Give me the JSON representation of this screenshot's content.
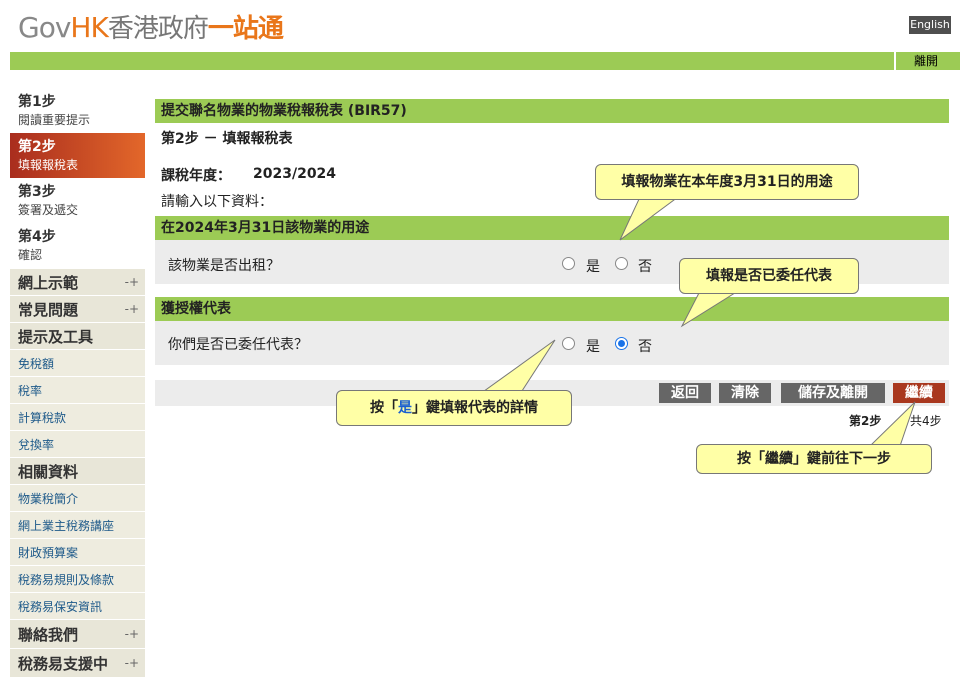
{
  "header": {
    "logo_gov": "Gov",
    "logo_hk": "HK",
    "logo_zh": "香港政府",
    "logo_zh_bold": "一站通",
    "english_label": "English",
    "logout_label": "離開"
  },
  "sidebar": {
    "steps": [
      {
        "num": "第1步",
        "desc": "閱讀重要提示"
      },
      {
        "num": "第2步",
        "desc": "填報報稅表"
      },
      {
        "num": "第3步",
        "desc": "簽署及遞交"
      },
      {
        "num": "第4步",
        "desc": "確認"
      }
    ],
    "nav": {
      "demo": "網上示範",
      "faq": "常見問題",
      "tips": "提示及工具",
      "tips_items": [
        "免稅額",
        "稅率",
        "計算稅款",
        "兌換率"
      ],
      "related": "相關資料",
      "related_items": [
        "物業稅簡介",
        "網上業主稅務講座",
        "財政預算案",
        "稅務易規則及條款",
        "稅務易保安資訊"
      ],
      "contact": "聯絡我們",
      "support": "稅務易支援中"
    }
  },
  "main": {
    "form_title": "提交聯名物業的物業稅報稅表 (BIR57)",
    "step_heading": "第2步  －  填報報稅表",
    "assessment_label": "課稅年度：",
    "assessment_year": "2023/2024",
    "instruction": "請輸入以下資料：",
    "section1_title": "在2024年3月31日該物業的用途",
    "q1": "該物業是否出租？",
    "section2_title": "獲授權代表",
    "q2": "你們是否已委任代表？",
    "yes_label": "是",
    "no_label": "否",
    "q1_value": "",
    "q2_value": "否",
    "buttons": {
      "back": "返回",
      "clear": "清除",
      "save_exit": "儲存及離開",
      "continue": "繼續"
    },
    "progress_current": "第2步",
    "progress_total": "共4步"
  },
  "callouts": {
    "usage": "填報物業在本年度3月31日的用途",
    "representative": "填報是否已委任代表",
    "yes_prefix": "按「",
    "yes_word": "是",
    "yes_suffix": "」鍵填報代表的詳情",
    "continue_text": "按「繼續」鍵前往下一步"
  },
  "colors": {
    "green": "#9ccb55",
    "active_step": "#a92d1e",
    "continue_button": "#a9381f",
    "callout_bg": "#ffffa6"
  }
}
